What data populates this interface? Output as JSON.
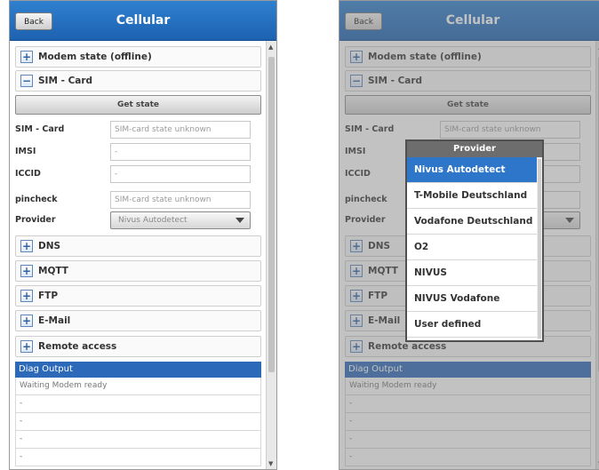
{
  "header": {
    "back_label": "Back",
    "title": "Cellular"
  },
  "sections": {
    "modem": "Modem state (offline)",
    "sim": "SIM - Card",
    "dns": "DNS",
    "mqtt": "MQTT",
    "ftp": "FTP",
    "email": "E-Mail",
    "remote": "Remote access"
  },
  "sim_card": {
    "get_state_label": "Get state",
    "sim_label": "SIM - Card",
    "sim_value": "SIM-card state unknown",
    "imsi_label": "IMSI",
    "imsi_value": "-",
    "iccid_label": "ICCID",
    "iccid_value": "-",
    "pincheck_label": "pincheck",
    "pincheck_value": "SIM-card state unknown",
    "provider_label": "Provider",
    "provider_value": "Nivus Autodetect"
  },
  "diag": {
    "title": "Diag Output",
    "lines": [
      "Waiting Modem ready",
      "-",
      "-",
      "-",
      "-"
    ]
  },
  "provider_popup": {
    "title": "Provider",
    "options": [
      "Nivus Autodetect",
      "T-Mobile Deutschland",
      "Vodafone Deutschland",
      "O2",
      "NIVUS",
      "NIVUS Vodafone",
      "User defined"
    ],
    "selected": "Nivus Autodetect"
  },
  "colors": {
    "header_blue": "#1d62b0",
    "accent": "#2e76c9"
  },
  "icons": {
    "expand": "plus-icon",
    "collapse": "minus-icon",
    "dropdown": "caret-down-icon"
  }
}
